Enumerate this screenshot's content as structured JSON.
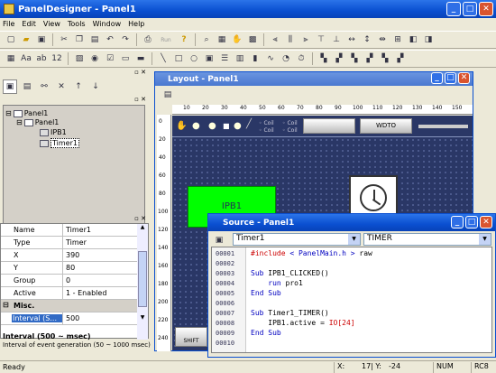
{
  "app": {
    "title": "PanelDesigner - Panel1"
  },
  "menu": [
    "File",
    "Edit",
    "View",
    "Tools",
    "Window",
    "Help"
  ],
  "toolbar": {
    "run_label": "Run"
  },
  "tree": {
    "root": "Panel1",
    "panel": "Panel1",
    "children": [
      "IPB1",
      "Timer1"
    ]
  },
  "props": {
    "rows": [
      {
        "k": "Name",
        "v": "Timer1"
      },
      {
        "k": "Type",
        "v": "Timer"
      },
      {
        "k": "X",
        "v": "390"
      },
      {
        "k": "Y",
        "v": "80"
      },
      {
        "k": "Group",
        "v": "0"
      },
      {
        "k": "Active",
        "v": "1 - Enabled"
      }
    ],
    "section": "Misc.",
    "selected": {
      "k": "Interval (S...",
      "v": "500"
    },
    "desc_title": "Interval (500 ~ msec)",
    "desc_text": "Interval of event generation (50 ~ 1000 msec)"
  },
  "layout": {
    "title": "Layout - Panel1",
    "ipb_label": "IPB1",
    "shift_label": "SHIFT",
    "wdto_label": "WDTO",
    "opt1": "Coil",
    "opt2": "Coil",
    "ruler_h": [
      "10",
      "20",
      "30",
      "40",
      "50",
      "60",
      "70",
      "80",
      "90",
      "100",
      "110",
      "120",
      "130",
      "140",
      "150"
    ],
    "ruler_v": [
      "0",
      "20",
      "40",
      "60",
      "80",
      "100",
      "120",
      "140",
      "160",
      "180",
      "200",
      "220",
      "240"
    ]
  },
  "source": {
    "title": "Source - Panel1",
    "object": "Timer1",
    "event": "TIMER",
    "lines": [
      {
        "n": "00001",
        "t": "#include < PanelMain.h > raw"
      },
      {
        "n": "00002",
        "t": ""
      },
      {
        "n": "00003",
        "t": "Sub IPB1_CLICKED()"
      },
      {
        "n": "00004",
        "t": "    run pro1"
      },
      {
        "n": "00005",
        "t": "End Sub"
      },
      {
        "n": "00006",
        "t": ""
      },
      {
        "n": "00007",
        "t": "Sub Timer1_TIMER()"
      },
      {
        "n": "00008",
        "t": "    IPB1.active = IO[24]"
      },
      {
        "n": "00009",
        "t": "End Sub"
      },
      {
        "n": "00010",
        "t": ""
      }
    ]
  },
  "status": {
    "ready": "Ready",
    "x": "X:",
    "y": "17| Y:",
    "yval": "-24",
    "num": "NUM",
    "rc": "RC8"
  },
  "colors": {
    "accent": "#0a4fd0",
    "canvas": "#2a3766",
    "button_green": "#00ff00"
  }
}
